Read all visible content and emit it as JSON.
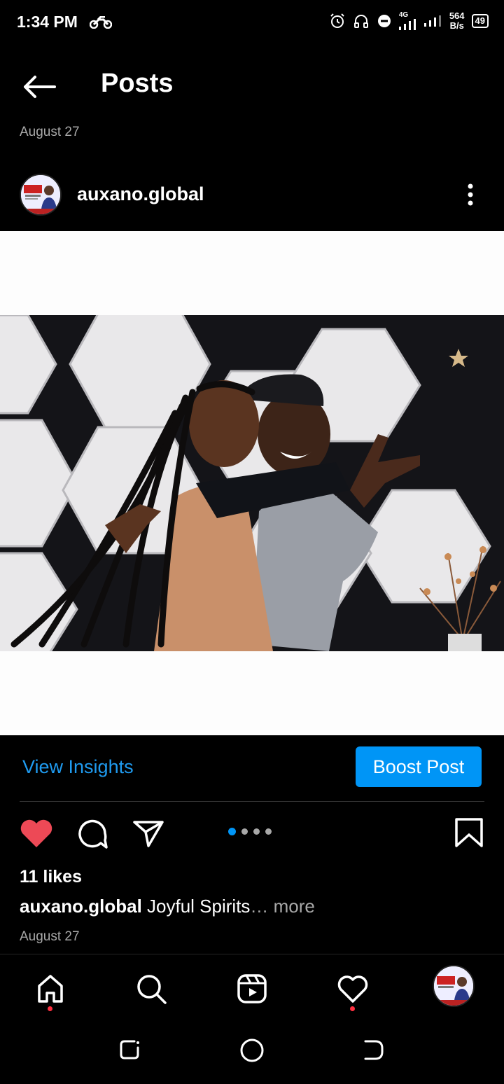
{
  "status_bar": {
    "time": "1:34 PM",
    "network_type": "4G",
    "net_speed_value": "564",
    "net_speed_unit": "B/s",
    "battery": "49"
  },
  "header": {
    "title": "Posts",
    "date": "August 27"
  },
  "post": {
    "username": "auxano.global",
    "likes": "11 likes",
    "caption_user": "auxano.global",
    "caption_text": " Joyful Spirits",
    "caption_ellipsis": "…",
    "caption_more": " more",
    "date": "August 27",
    "carousel_count": 4,
    "carousel_active_index": 0,
    "liked": true
  },
  "insights": {
    "view_insights_label": "View Insights",
    "boost_label": "Boost Post"
  },
  "colors": {
    "accent_blue": "#0095f6",
    "link_blue": "#1f9bf0",
    "like_red": "#ed4956",
    "notification_dot": "#ff3040",
    "secondary_text": "#a8a8a8"
  },
  "icons": {
    "back": "arrow-left-icon",
    "more": "more-vertical-icon",
    "like": "heart-filled-icon",
    "comment": "comment-icon",
    "share": "paper-plane-icon",
    "save": "bookmark-icon",
    "nav": [
      "home-icon",
      "search-icon",
      "reels-icon",
      "heart-icon",
      "profile-avatar"
    ]
  }
}
